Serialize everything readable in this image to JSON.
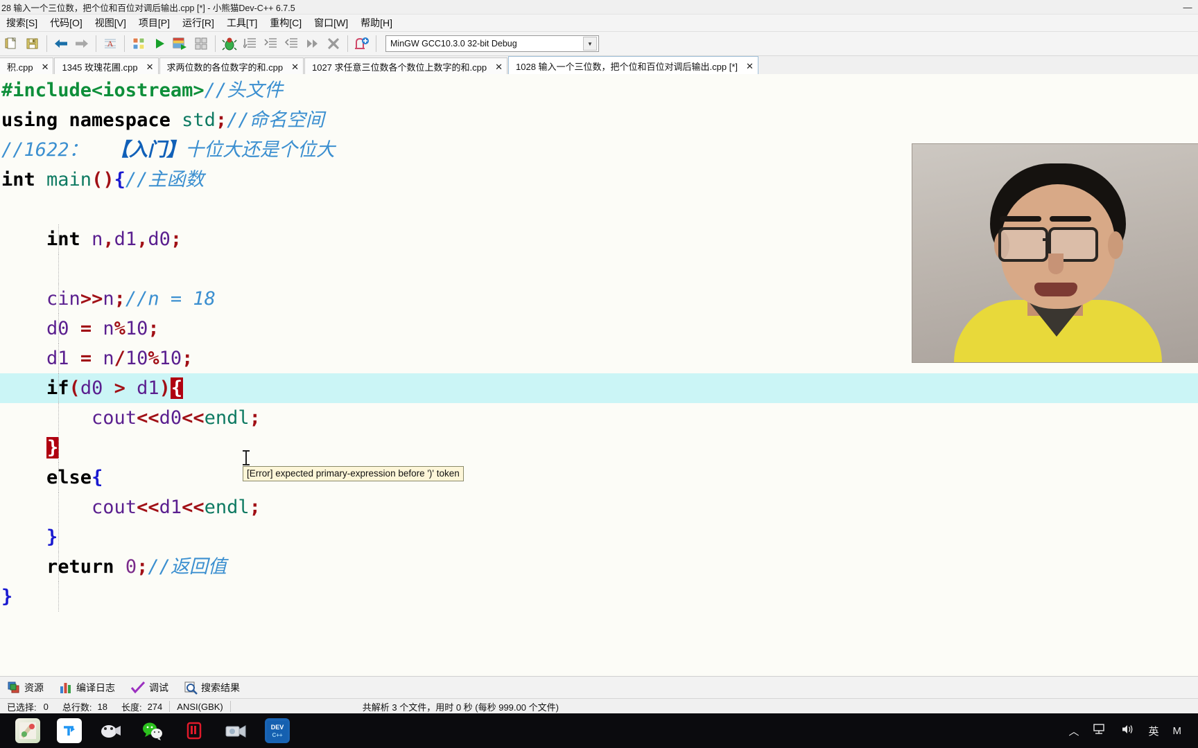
{
  "window": {
    "title": "28 输入一个三位数，把个位和百位对调后输出.cpp [*] - 小熊猫Dev-C++ 6.7.5",
    "minimize": "—",
    "maximize": "❐",
    "close": "✕"
  },
  "menu": {
    "items": [
      {
        "label": "搜索[S]",
        "name": "menu-search"
      },
      {
        "label": "代码[O]",
        "name": "menu-code"
      },
      {
        "label": "视图[V]",
        "name": "menu-view"
      },
      {
        "label": "项目[P]",
        "name": "menu-project"
      },
      {
        "label": "运行[R]",
        "name": "menu-run"
      },
      {
        "label": "工具[T]",
        "name": "menu-tools"
      },
      {
        "label": "重构[C]",
        "name": "menu-refactor"
      },
      {
        "label": "窗口[W]",
        "name": "menu-window"
      },
      {
        "label": "帮助[H]",
        "name": "menu-help"
      }
    ]
  },
  "toolbar": {
    "compiler_set": "MinGW GCC10.3.0 32-bit Debug",
    "dropdown_arrow": "▼",
    "icons": [
      "new-file-icon",
      "save-icon",
      "back-arrow-icon",
      "forward-arrow-icon",
      "find-icon",
      "compile-icon",
      "run-icon",
      "compile-run-icon",
      "rebuild-icon",
      "debug-icon",
      "step-into-icon",
      "step-over-icon",
      "step-out-icon",
      "continue-icon",
      "stop-icon",
      "add-breakpoint-icon"
    ]
  },
  "tabs": {
    "close_glyph": "✕",
    "items": [
      {
        "label": "积.cpp",
        "active": false
      },
      {
        "label": "1345 玫瑰花圃.cpp",
        "active": false
      },
      {
        "label": "求两位数的各位数字的和.cpp",
        "active": false
      },
      {
        "label": "1027 求任意三位数各个数位上数字的和.cpp",
        "active": false
      },
      {
        "label": "1028 输入一个三位数，把个位和百位对调后输出.cpp [*]",
        "active": true
      }
    ]
  },
  "editor": {
    "tooltip": "[Error] expected primary-expression before ')' token",
    "lines": [
      {
        "tokens": [
          {
            "t": "#include<iostream>",
            "c": "pre"
          },
          {
            "t": "//头文件",
            "c": "cmt"
          }
        ]
      },
      {
        "tokens": [
          {
            "t": "using namespace ",
            "c": "kw"
          },
          {
            "t": "std",
            "c": "typ"
          },
          {
            "t": ";",
            "c": "pun"
          },
          {
            "t": "//命名空间",
            "c": "cmt"
          }
        ]
      },
      {
        "tokens": [
          {
            "t": "//1622：",
            "c": "cmt"
          },
          {
            "t": "  【入门】",
            "c": "cmt-b"
          },
          {
            "t": "十位大还是个位大",
            "c": "cmt"
          }
        ]
      },
      {
        "tokens": [
          {
            "t": "int ",
            "c": "kw"
          },
          {
            "t": "main",
            "c": "typ"
          },
          {
            "t": "()",
            "c": "pun"
          },
          {
            "t": "{",
            "c": "brc"
          },
          {
            "t": "//主函数",
            "c": "cmt"
          }
        ]
      },
      {
        "tokens": []
      },
      {
        "tokens": [
          {
            "t": "    ",
            "c": "ind"
          },
          {
            "t": "int ",
            "c": "kw"
          },
          {
            "t": "n",
            "c": "var"
          },
          {
            "t": ",",
            "c": "pun"
          },
          {
            "t": "d1",
            "c": "var"
          },
          {
            "t": ",",
            "c": "pun"
          },
          {
            "t": "d0",
            "c": "var"
          },
          {
            "t": ";",
            "c": "pun"
          }
        ]
      },
      {
        "tokens": []
      },
      {
        "tokens": [
          {
            "t": "    ",
            "c": "ind"
          },
          {
            "t": "cin",
            "c": "var"
          },
          {
            "t": ">>",
            "c": "pun"
          },
          {
            "t": "n",
            "c": "var"
          },
          {
            "t": ";",
            "c": "pun"
          },
          {
            "t": "//n = 18",
            "c": "cmt"
          }
        ]
      },
      {
        "tokens": [
          {
            "t": "    ",
            "c": "ind"
          },
          {
            "t": "d0 ",
            "c": "var"
          },
          {
            "t": "= ",
            "c": "pun"
          },
          {
            "t": "n",
            "c": "var"
          },
          {
            "t": "%",
            "c": "pun"
          },
          {
            "t": "10",
            "c": "var"
          },
          {
            "t": ";",
            "c": "pun"
          }
        ]
      },
      {
        "tokens": [
          {
            "t": "    ",
            "c": "ind"
          },
          {
            "t": "d1 ",
            "c": "var"
          },
          {
            "t": "= ",
            "c": "pun"
          },
          {
            "t": "n",
            "c": "var"
          },
          {
            "t": "/",
            "c": "pun"
          },
          {
            "t": "10",
            "c": "var"
          },
          {
            "t": "%",
            "c": "pun"
          },
          {
            "t": "10",
            "c": "var"
          },
          {
            "t": ";",
            "c": "pun"
          }
        ]
      },
      {
        "highlight": true,
        "tokens": [
          {
            "t": "    ",
            "c": "ind"
          },
          {
            "t": "if",
            "c": "kw"
          },
          {
            "t": "(",
            "c": "pun"
          },
          {
            "t": "d0 ",
            "c": "var"
          },
          {
            "t": "> ",
            "c": "pun"
          },
          {
            "t": "d1",
            "c": "var"
          },
          {
            "t": ")",
            "c": "pun"
          },
          {
            "t": "{",
            "c": "brc-err"
          }
        ]
      },
      {
        "tokens": [
          {
            "t": "        ",
            "c": "ind"
          },
          {
            "t": "cout",
            "c": "var"
          },
          {
            "t": "<<",
            "c": "pun"
          },
          {
            "t": "d0",
            "c": "var"
          },
          {
            "t": "<<",
            "c": "pun"
          },
          {
            "t": "endl",
            "c": "typ"
          },
          {
            "t": ";",
            "c": "pun"
          }
        ]
      },
      {
        "tokens": [
          {
            "t": "    ",
            "c": "ind"
          },
          {
            "t": "}",
            "c": "brc-err"
          }
        ]
      },
      {
        "tokens": [
          {
            "t": "    ",
            "c": "ind"
          },
          {
            "t": "else",
            "c": "kw"
          },
          {
            "t": "{",
            "c": "brc"
          }
        ]
      },
      {
        "tokens": [
          {
            "t": "        ",
            "c": "ind"
          },
          {
            "t": "cout",
            "c": "var"
          },
          {
            "t": "<<",
            "c": "pun"
          },
          {
            "t": "d1",
            "c": "var"
          },
          {
            "t": "<<",
            "c": "pun"
          },
          {
            "t": "endl",
            "c": "typ"
          },
          {
            "t": ";",
            "c": "pun"
          }
        ]
      },
      {
        "tokens": [
          {
            "t": "    ",
            "c": "ind"
          },
          {
            "t": "}",
            "c": "brc"
          }
        ]
      },
      {
        "tokens": [
          {
            "t": "    ",
            "c": "ind"
          },
          {
            "t": "return ",
            "c": "kw"
          },
          {
            "t": "0",
            "c": "num"
          },
          {
            "t": ";",
            "c": "pun"
          },
          {
            "t": "//返回值",
            "c": "cmt"
          }
        ]
      },
      {
        "tokens": [
          {
            "t": "}",
            "c": "brc"
          }
        ]
      }
    ]
  },
  "panel": {
    "items": [
      {
        "label": "资源",
        "icon": "resources-icon"
      },
      {
        "label": "编译日志",
        "icon": "compile-log-icon"
      },
      {
        "label": "调试",
        "icon": "debug-check-icon"
      },
      {
        "label": "搜索结果",
        "icon": "search-results-icon"
      }
    ]
  },
  "status": {
    "selected_label": "已选择:",
    "selected_value": "0",
    "lines_label": "总行数:",
    "lines_value": "18",
    "length_label": "长度:",
    "length_value": "274",
    "encoding": "ANSI(GBK)",
    "parse_info": "共解析 3 个文件，用时 0 秒 (每秒 999.00 个文件)"
  },
  "taskbar": {
    "apps": [
      "paint-icon",
      "tim-icon",
      "tencent-meeting-icon",
      "wechat-icon",
      "recorder-icon",
      "camera-icon",
      "devcpp-icon"
    ],
    "tray": {
      "chevron_up": "︿",
      "network": "🖵",
      "volume": "🔊",
      "ime": "英",
      "more": "M"
    }
  },
  "colors": {
    "highlight_line": "#cbf5f6",
    "error_brace_bg": "#b00010",
    "comment": "#3b8fd0",
    "keyword": "#000000",
    "preprocessor": "#0e8f3a",
    "identifier": "#5a1f8f",
    "punctuation": "#a11016",
    "tooltip_bg": "#fdf6d8"
  }
}
